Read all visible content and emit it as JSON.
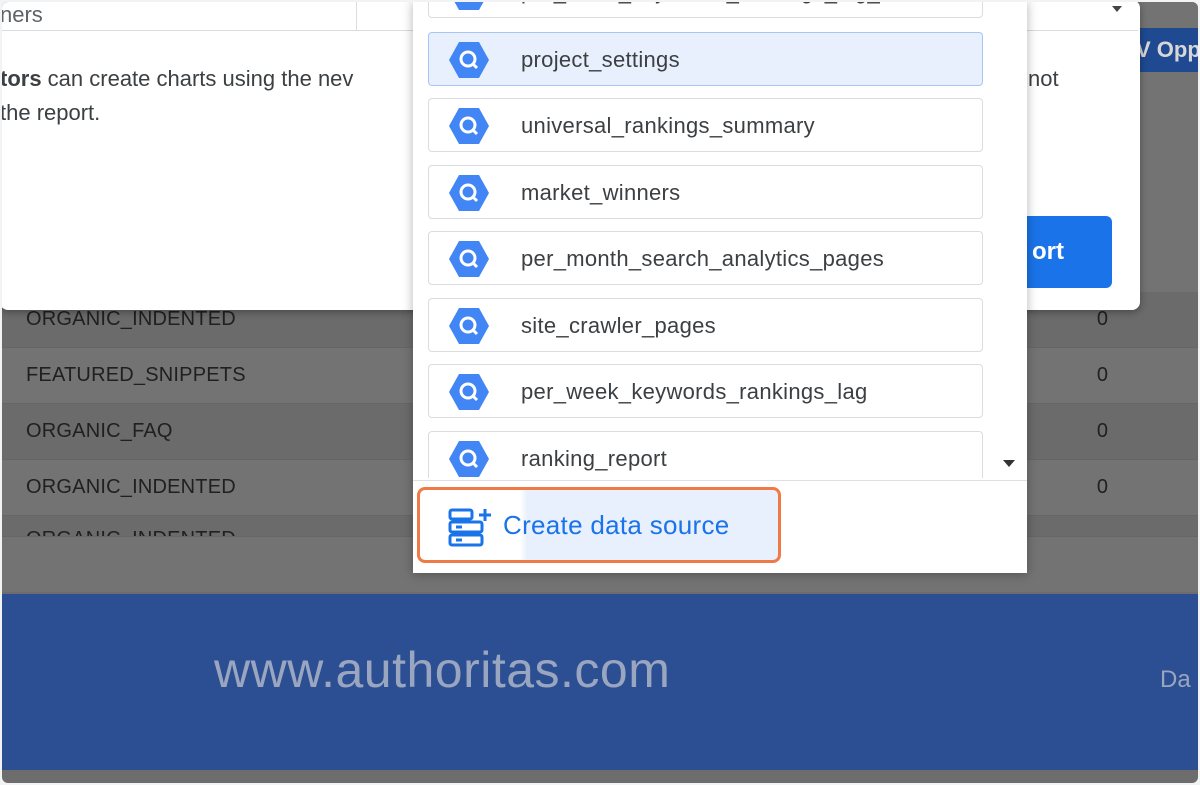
{
  "report": {
    "header_cell": "V Opp",
    "rows": [
      {
        "label": "ORGANIC_INDENTED",
        "value": "0"
      },
      {
        "label": "FEATURED_SNIPPETS",
        "value": "0"
      },
      {
        "label": "ORGANIC_FAQ",
        "value": "0"
      },
      {
        "label": "ORGANIC_INDENTED",
        "value": "0"
      },
      {
        "label": "ORGANIC_INDENTED",
        "value": "-"
      }
    ],
    "footer_site": "www.authoritas.com",
    "footer_right": "Da"
  },
  "dialog": {
    "select_text": "ners",
    "text_bold": "tors",
    "text_line1": " can create charts using the nev",
    "text_line2": "the report.",
    "text_right": "not",
    "primary_button_label": "ort"
  },
  "dropdown": {
    "items": [
      {
        "label": "per_week_keywords_rankings_lag_cut",
        "selected": false
      },
      {
        "label": "project_settings",
        "selected": true
      },
      {
        "label": "universal_rankings_summary",
        "selected": false
      },
      {
        "label": "market_winners",
        "selected": false
      },
      {
        "label": "per_month_search_analytics_pages",
        "selected": false
      },
      {
        "label": "site_crawler_pages",
        "selected": false
      },
      {
        "label": "per_week_keywords_rankings_lag",
        "selected": false
      },
      {
        "label": "ranking_report",
        "selected": false
      }
    ],
    "item_icon": "bigquery-icon",
    "create_label": "Create data source",
    "create_icon": "create-data-source-icon"
  },
  "colors": {
    "accent": "#1a73e8",
    "highlight_border": "#ef7a46",
    "footer_bg": "#2c4f93",
    "selected_bg": "#e8f0fe"
  }
}
